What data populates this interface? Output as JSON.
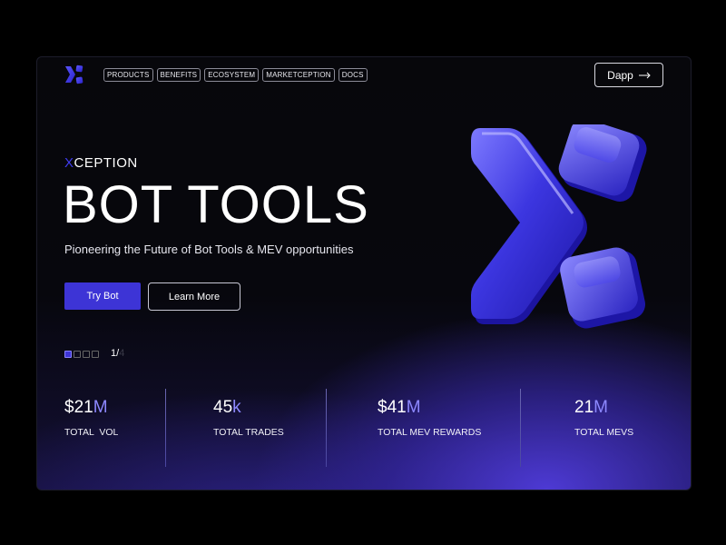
{
  "nav": {
    "items": [
      "PRODUCTS",
      "BENEFITS",
      "ECOSYSTEM",
      "MARKETCEPTION",
      "DOCS"
    ],
    "dapp_label": "Dapp",
    "dapp_icon": "arrow-right-icon"
  },
  "hero": {
    "kicker_prefix": "X",
    "kicker_rest": "CEPTION",
    "title": "BOT TOOLS",
    "subtitle": "Pioneering the Future of Bot Tools & MEV opportunities",
    "primary_button": "Try Bot",
    "secondary_button": "Learn More",
    "pager_current": "1/",
    "pager_total": "4",
    "pager_dots": 4
  },
  "stats": [
    {
      "value_main": "$21",
      "value_tail": "M",
      "label": "TOTAL  VOL"
    },
    {
      "value_main": "45",
      "value_tail": "k",
      "label": "TOTAL TRADES"
    },
    {
      "value_main": "$41",
      "value_tail": "M",
      "label": "TOTAL MEV REWARDS"
    },
    {
      "value_main": "21",
      "value_tail": "M",
      "label": "TOTAL MEVS"
    }
  ],
  "colors": {
    "accent": "#3d34d6",
    "accent_light": "#8d88ff",
    "background": "#07070b"
  }
}
